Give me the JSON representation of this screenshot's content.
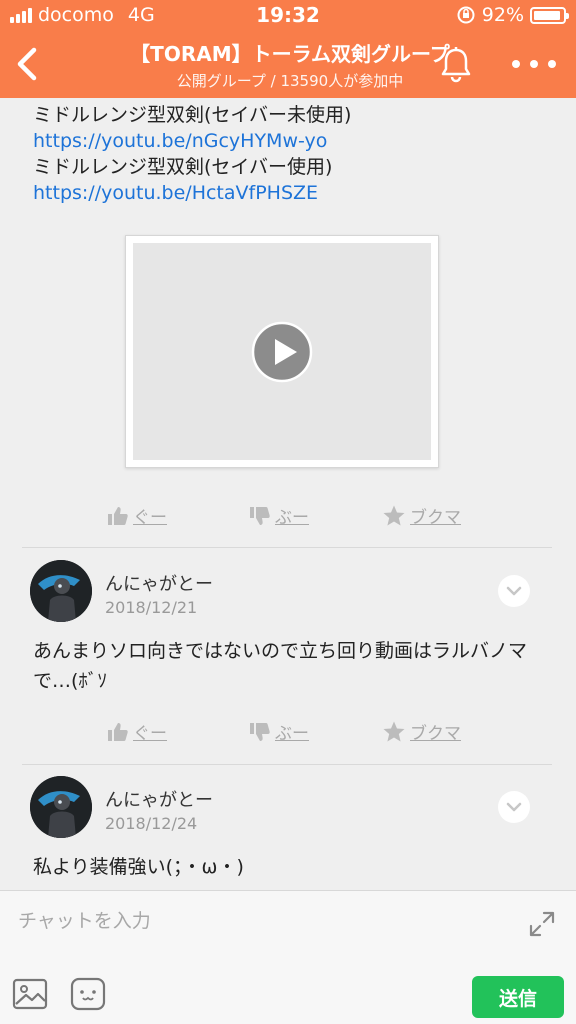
{
  "status_bar": {
    "carrier": "docomo",
    "network": "4G",
    "time": "19:32",
    "battery_text": "92%",
    "battery_level": 0.92
  },
  "header": {
    "title": "【TORAM】トーラム双剣グループ",
    "subtitle": "公開グループ / 13590人が参加中",
    "color": "#f97d4a"
  },
  "post": {
    "lines": [
      {
        "type": "text",
        "text": "ミドルレンジ型双剣(セイバー未使用)"
      },
      {
        "type": "link",
        "text": "https://youtu.be/nGcyHYMw-yo"
      },
      {
        "type": "text",
        "text": "ミドルレンジ型双剣(セイバー使用)"
      },
      {
        "type": "link",
        "text": "https://youtu.be/HctaVfPHSZE"
      }
    ]
  },
  "actions": {
    "like": "ぐー",
    "dislike": "ぶー",
    "bookmark": "ブクマ"
  },
  "comments": [
    {
      "name": "んにゃがとー",
      "date": "2018/12/21",
      "text": "あんまりソロ向きではないので立ち回り動画はラルバノマで…(ﾎﾞｿ"
    },
    {
      "name": "んにゃがとー",
      "date": "2018/12/24",
      "text": "私より装備強い(；・ω・)"
    }
  ],
  "input_bar": {
    "placeholder": "チャットを入力",
    "send_label": "送信",
    "send_color": "#22c25a"
  },
  "icons": [
    "back-icon",
    "bell-icon",
    "more-icon",
    "play-icon",
    "thumbs-up-icon",
    "thumbs-down-icon",
    "star-icon",
    "chevron-down-icon",
    "expand-icon",
    "image-icon",
    "emoji-icon"
  ]
}
